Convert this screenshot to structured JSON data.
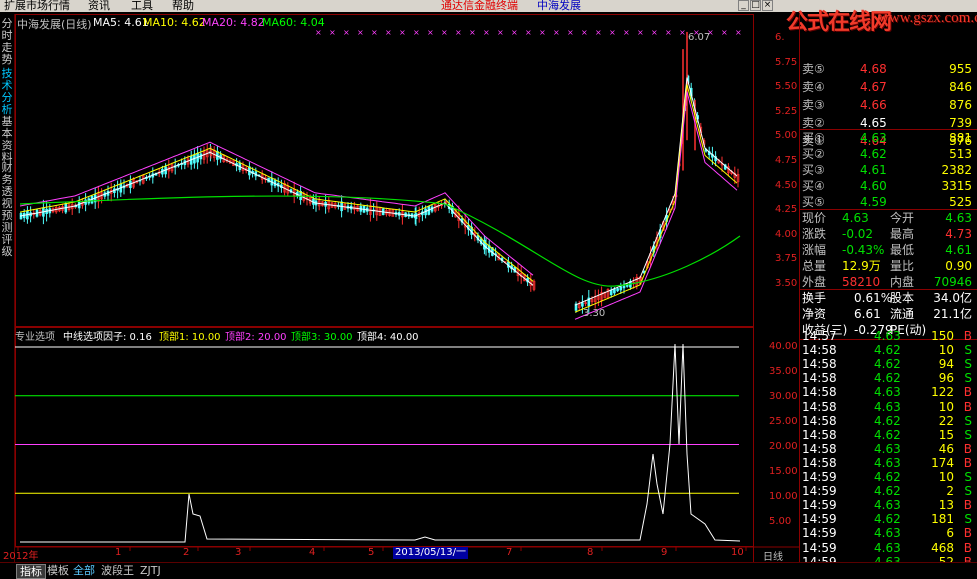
{
  "menu": {
    "items": [
      "扩展市场行情",
      "资讯",
      "工具",
      "帮助"
    ],
    "brand": "通达信金融终端",
    "stock_title": "中海发展"
  },
  "watermark": {
    "text": "公式在线网",
    "url": "www.gszx.com.cn"
  },
  "sidebar": {
    "tabs": [
      "分时走势",
      "技术分析",
      "基本资料",
      "财务透视",
      "预测评级"
    ],
    "active": 1
  },
  "main_chart": {
    "name": "中海发展(日线)",
    "ma": [
      {
        "label": "MA5: 4.61",
        "color": "#ffffff"
      },
      {
        "label": "MA10: 4.62",
        "color": "#ffff00"
      },
      {
        "label": "MA20: 4.82",
        "color": "#ff40ff"
      },
      {
        "label": "MA60: 4.04",
        "color": "#00ff00"
      }
    ],
    "y_ticks": [
      "6.",
      "5.75",
      "5.50",
      "5.25",
      "5.00",
      "4.75",
      "4.50",
      "4.25",
      "4.00",
      "3.75",
      "3.50"
    ],
    "high_label": "6.07",
    "low_label": "3.30"
  },
  "indicator": {
    "name": "专业选项",
    "title": "中线选项因子: 0.16",
    "levels": [
      {
        "label": "顶部1: 10.00",
        "color": "#ffff00",
        "value": 10
      },
      {
        "label": "顶部2: 20.00",
        "color": "#ff40ff",
        "value": 20
      },
      {
        "label": "顶部3: 30.00",
        "color": "#00ff00",
        "value": 30
      },
      {
        "label": "顶部4: 40.00",
        "color": "#ffffff",
        "value": 40
      }
    ],
    "y_ticks": [
      "40.00",
      "35.00",
      "30.00",
      "25.00",
      "20.00",
      "15.00",
      "10.00",
      "5.00"
    ]
  },
  "x_axis": {
    "labels": [
      "2012年",
      "1",
      "2",
      "3",
      "4",
      "5",
      "7",
      "8",
      "9",
      "10"
    ],
    "cursor_date": "2013/05/13/一",
    "period": "日线"
  },
  "quote": {
    "asks": [
      {
        "label": "卖⑤",
        "price": "4.68",
        "vol": "955"
      },
      {
        "label": "卖④",
        "price": "4.67",
        "vol": "846"
      },
      {
        "label": "卖③",
        "price": "4.66",
        "vol": "876"
      },
      {
        "label": "卖②",
        "price": "4.65",
        "vol": "739"
      },
      {
        "label": "卖①",
        "price": "4.64",
        "vol": "376"
      }
    ],
    "bids": [
      {
        "label": "买①",
        "price": "4.63",
        "vol": "881"
      },
      {
        "label": "买②",
        "price": "4.62",
        "vol": "513"
      },
      {
        "label": "买③",
        "price": "4.61",
        "vol": "2382"
      },
      {
        "label": "买④",
        "price": "4.60",
        "vol": "3315"
      },
      {
        "label": "买⑤",
        "price": "4.59",
        "vol": "525"
      }
    ],
    "stats": [
      {
        "l1": "现价",
        "v1": "4.63",
        "c1": "c-green",
        "l2": "今开",
        "v2": "4.63",
        "c2": "c-green"
      },
      {
        "l1": "涨跌",
        "v1": "-0.02",
        "c1": "c-green",
        "l2": "最高",
        "v2": "4.73",
        "c2": "c-red"
      },
      {
        "l1": "涨幅",
        "v1": "-0.43%",
        "c1": "c-green",
        "l2": "最低",
        "v2": "4.61",
        "c2": "c-green"
      },
      {
        "l1": "总量",
        "v1": "12.9万",
        "c1": "c-yellow",
        "l2": "量比",
        "v2": "0.90",
        "c2": "c-yellow"
      },
      {
        "l1": "外盘",
        "v1": "58210",
        "c1": "c-red",
        "l2": "内盘",
        "v2": "70946",
        "c2": "c-green"
      }
    ],
    "fundamentals": [
      {
        "l1": "换手",
        "v1": "0.61%",
        "l2": "股本",
        "v2": "34.0亿"
      },
      {
        "l1": "净资",
        "v1": "6.61",
        "l2": "流通",
        "v2": "21.1亿"
      },
      {
        "l1": "收益(三)",
        "v1": "-0.279",
        "l2": "PE(动)",
        "v2": ""
      }
    ],
    "ticks": [
      {
        "t": "14:57",
        "p": "4.63",
        "v": "150",
        "s": "B"
      },
      {
        "t": "14:58",
        "p": "4.62",
        "v": "10",
        "s": "S"
      },
      {
        "t": "14:58",
        "p": "4.62",
        "v": "94",
        "s": "S"
      },
      {
        "t": "14:58",
        "p": "4.62",
        "v": "96",
        "s": "S"
      },
      {
        "t": "14:58",
        "p": "4.63",
        "v": "122",
        "s": "B"
      },
      {
        "t": "14:58",
        "p": "4.63",
        "v": "10",
        "s": "B"
      },
      {
        "t": "14:58",
        "p": "4.62",
        "v": "22",
        "s": "S"
      },
      {
        "t": "14:58",
        "p": "4.62",
        "v": "15",
        "s": "S"
      },
      {
        "t": "14:58",
        "p": "4.63",
        "v": "46",
        "s": "B"
      },
      {
        "t": "14:58",
        "p": "4.63",
        "v": "174",
        "s": "B"
      },
      {
        "t": "14:59",
        "p": "4.62",
        "v": "10",
        "s": "S"
      },
      {
        "t": "14:59",
        "p": "4.62",
        "v": "2",
        "s": "S"
      },
      {
        "t": "14:59",
        "p": "4.63",
        "v": "13",
        "s": "B"
      },
      {
        "t": "14:59",
        "p": "4.62",
        "v": "181",
        "s": "S"
      },
      {
        "t": "14:59",
        "p": "4.63",
        "v": "6",
        "s": "B"
      },
      {
        "t": "14:59",
        "p": "4.63",
        "v": "468",
        "b": "",
        "s": "B"
      },
      {
        "t": "14:59",
        "p": "4.63",
        "v": "52",
        "s": "B"
      }
    ]
  },
  "bottom_tabs": [
    "指标",
    "模板",
    "全部",
    "波段王",
    "ZJTJ"
  ]
}
